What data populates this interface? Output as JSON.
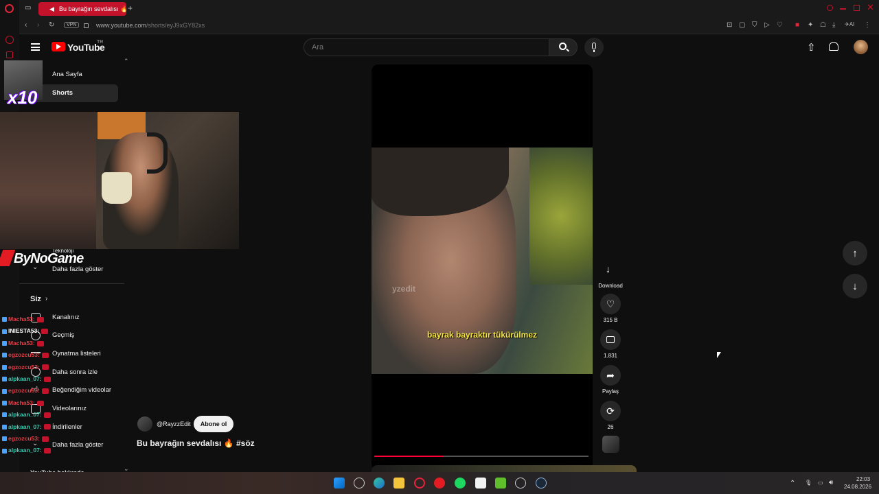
{
  "browser": {
    "tab_title": "Bu bayrağın sevdalısı 🔥",
    "new_tab_icon": "+",
    "vpn_label": "VPN",
    "url_host": "www.youtube.com",
    "url_path": "/shorts/eyJ9xGY82xs"
  },
  "youtube": {
    "logo_text": "YouTube",
    "country_code": "TR",
    "search_placeholder": "Ara"
  },
  "sidebar": {
    "items": [
      {
        "label": "Ana Sayfa"
      },
      {
        "label": "Shorts"
      },
      {
        "label": "Teknoloji"
      },
      {
        "label": "Daha fazla göster"
      }
    ],
    "you_header": "Siz",
    "you_items": [
      {
        "label": "Kanalınız"
      },
      {
        "label": "Geçmiş"
      },
      {
        "label": "Oynatma listeleri"
      },
      {
        "label": "Daha sonra izle"
      },
      {
        "label": "Beğendiğim videolar"
      },
      {
        "label": "Videolarınız"
      },
      {
        "label": "İndirilenler"
      },
      {
        "label": "Daha fazla göster"
      }
    ],
    "bottom_partial": "YouTube hakkında"
  },
  "stream_overlay": {
    "multiplier": "x10",
    "sponsor": "ByNoGame",
    "chat": [
      {
        "user": "Macha53:",
        "color": "#e2404a"
      },
      {
        "user": "INIESTA53:",
        "color": "#ffffff"
      },
      {
        "user": "Macha53:",
        "color": "#e2404a"
      },
      {
        "user": "egzozcu53:",
        "color": "#e2404a"
      },
      {
        "user": "egzozcu53:",
        "color": "#e2404a"
      },
      {
        "user": "alpkaan_07:",
        "color": "#36c9b0"
      },
      {
        "user": "egzozcu53:",
        "color": "#e2404a"
      },
      {
        "user": "Macha53:",
        "color": "#e2404a"
      },
      {
        "user": "alpkaan_07:",
        "color": "#36c9b0"
      },
      {
        "user": "alpkaan_07:",
        "color": "#36c9b0"
      },
      {
        "user": "egzozcu53:",
        "color": "#e2404a"
      },
      {
        "user": "alpkaan_07:",
        "color": "#36c9b0"
      }
    ]
  },
  "short": {
    "subtitle": "bayrak bayraktır tükürülmez",
    "watermark": "yzedit",
    "progress": 0.32,
    "channel": "@RayzzEdit",
    "subscribe_label": "Abone ol",
    "title": "Bu bayrağın sevdalısı 🔥 #söz"
  },
  "actions": {
    "download": {
      "icon": "download-icon",
      "label": "Download"
    },
    "like": {
      "icon": "heart-icon",
      "count": "315 B"
    },
    "comment": {
      "icon": "comment-icon",
      "count": "1.831"
    },
    "share": {
      "icon": "share-icon",
      "label": "Paylaş"
    },
    "remix": {
      "icon": "remix-icon",
      "count": "26"
    }
  },
  "taskbar": {
    "time": "22:03",
    "date": "24.08.2026"
  },
  "colors": {
    "accent_red": "#ff0000",
    "opera_red": "#c4122a",
    "subtitle_yellow": "#f5e63b",
    "progress_red": "#ff0033"
  }
}
